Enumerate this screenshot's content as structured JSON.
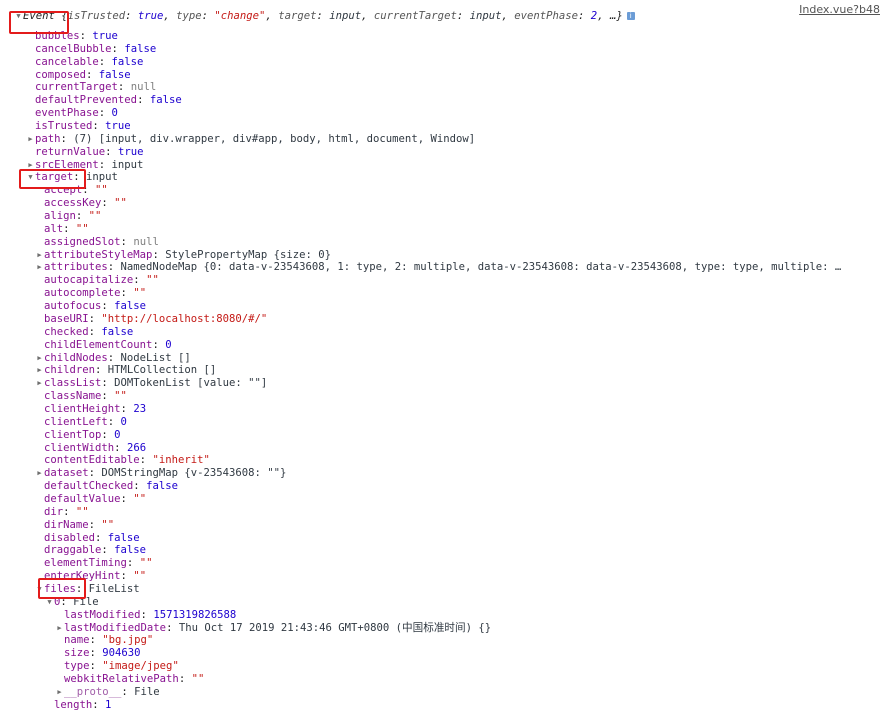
{
  "source_link": "Index.vue?b48",
  "event": {
    "name": "Event",
    "summary_open": "{",
    "summary_items": [
      {
        "key": "isTrusted",
        "val": "true",
        "t": "kw"
      },
      {
        "key": "type",
        "val": "\"change\"",
        "t": "str"
      },
      {
        "key": "target",
        "val": "input",
        "t": "obj"
      },
      {
        "key": "currentTarget",
        "val": "input",
        "t": "obj"
      },
      {
        "key": "eventPhase",
        "val": "2",
        "t": "num"
      }
    ],
    "summary_tail": ", …}",
    "info_icon": "i"
  },
  "lines": [
    {
      "i": 1,
      "tri": "",
      "key": "bubbles",
      "val": "true",
      "t": "kw"
    },
    {
      "i": 1,
      "tri": "",
      "key": "cancelBubble",
      "val": "false",
      "t": "kw"
    },
    {
      "i": 1,
      "tri": "",
      "key": "cancelable",
      "val": "false",
      "t": "kw"
    },
    {
      "i": 1,
      "tri": "",
      "key": "composed",
      "val": "false",
      "t": "kw"
    },
    {
      "i": 1,
      "tri": "",
      "key": "currentTarget",
      "val": "null",
      "t": "nul"
    },
    {
      "i": 1,
      "tri": "",
      "key": "defaultPrevented",
      "val": "false",
      "t": "kw"
    },
    {
      "i": 1,
      "tri": "",
      "key": "eventPhase",
      "val": "0",
      "t": "num"
    },
    {
      "i": 1,
      "tri": "",
      "key": "isTrusted",
      "val": "true",
      "t": "kw"
    },
    {
      "i": 1,
      "tri": "▶",
      "key": "path",
      "val": "(7) [input, div.wrapper, div#app, body, html, document, Window]",
      "t": "obj"
    },
    {
      "i": 1,
      "tri": "",
      "key": "returnValue",
      "val": "true",
      "t": "kw"
    },
    {
      "i": 1,
      "tri": "▶",
      "key": "srcElement",
      "val": "input",
      "t": "obj"
    },
    {
      "i": 1,
      "tri": "▼",
      "key": "target",
      "val": "input",
      "t": "obj"
    },
    {
      "i": 2,
      "tri": "",
      "key": "accept",
      "val": "\"\"",
      "t": "str"
    },
    {
      "i": 2,
      "tri": "",
      "key": "accessKey",
      "val": "\"\"",
      "t": "str"
    },
    {
      "i": 2,
      "tri": "",
      "key": "align",
      "val": "\"\"",
      "t": "str"
    },
    {
      "i": 2,
      "tri": "",
      "key": "alt",
      "val": "\"\"",
      "t": "str"
    },
    {
      "i": 2,
      "tri": "",
      "key": "assignedSlot",
      "val": "null",
      "t": "nul"
    },
    {
      "i": 2,
      "tri": "▶",
      "key": "attributeStyleMap",
      "val": "StylePropertyMap {size: 0}",
      "t": "obj"
    },
    {
      "i": 2,
      "tri": "▶",
      "key": "attributes",
      "val": "NamedNodeMap {0: data-v-23543608, 1: type, 2: multiple, data-v-23543608: data-v-23543608, type: type, multiple: …",
      "t": "obj"
    },
    {
      "i": 2,
      "tri": "",
      "key": "autocapitalize",
      "val": "\"\"",
      "t": "str"
    },
    {
      "i": 2,
      "tri": "",
      "key": "autocomplete",
      "val": "\"\"",
      "t": "str"
    },
    {
      "i": 2,
      "tri": "",
      "key": "autofocus",
      "val": "false",
      "t": "kw"
    },
    {
      "i": 2,
      "tri": "",
      "key": "baseURI",
      "val": "\"http://localhost:8080/#/\"",
      "t": "str"
    },
    {
      "i": 2,
      "tri": "",
      "key": "checked",
      "val": "false",
      "t": "kw"
    },
    {
      "i": 2,
      "tri": "",
      "key": "childElementCount",
      "val": "0",
      "t": "num"
    },
    {
      "i": 2,
      "tri": "▶",
      "key": "childNodes",
      "val": "NodeList []",
      "t": "obj"
    },
    {
      "i": 2,
      "tri": "▶",
      "key": "children",
      "val": "HTMLCollection []",
      "t": "obj"
    },
    {
      "i": 2,
      "tri": "▶",
      "key": "classList",
      "val": "DOMTokenList [value: \"\"]",
      "t": "obj"
    },
    {
      "i": 2,
      "tri": "",
      "key": "className",
      "val": "\"\"",
      "t": "str"
    },
    {
      "i": 2,
      "tri": "",
      "key": "clientHeight",
      "val": "23",
      "t": "num"
    },
    {
      "i": 2,
      "tri": "",
      "key": "clientLeft",
      "val": "0",
      "t": "num"
    },
    {
      "i": 2,
      "tri": "",
      "key": "clientTop",
      "val": "0",
      "t": "num"
    },
    {
      "i": 2,
      "tri": "",
      "key": "clientWidth",
      "val": "266",
      "t": "num"
    },
    {
      "i": 2,
      "tri": "",
      "key": "contentEditable",
      "val": "\"inherit\"",
      "t": "str"
    },
    {
      "i": 2,
      "tri": "▶",
      "key": "dataset",
      "val": "DOMStringMap {v-23543608: \"\"}",
      "t": "obj"
    },
    {
      "i": 2,
      "tri": "",
      "key": "defaultChecked",
      "val": "false",
      "t": "kw"
    },
    {
      "i": 2,
      "tri": "",
      "key": "defaultValue",
      "val": "\"\"",
      "t": "str"
    },
    {
      "i": 2,
      "tri": "",
      "key": "dir",
      "val": "\"\"",
      "t": "str"
    },
    {
      "i": 2,
      "tri": "",
      "key": "dirName",
      "val": "\"\"",
      "t": "str"
    },
    {
      "i": 2,
      "tri": "",
      "key": "disabled",
      "val": "false",
      "t": "kw"
    },
    {
      "i": 2,
      "tri": "",
      "key": "draggable",
      "val": "false",
      "t": "kw"
    },
    {
      "i": 2,
      "tri": "",
      "key": "elementTiming",
      "val": "\"\"",
      "t": "str"
    },
    {
      "i": 2,
      "tri": "",
      "key": "enterKeyHint",
      "val": "\"\"",
      "t": "str"
    },
    {
      "i": 2,
      "tri": "▼",
      "key": "files",
      "val": "FileList",
      "t": "obj"
    },
    {
      "i": 3,
      "tri": "▼",
      "key": "0",
      "val": "File",
      "t": "obj"
    },
    {
      "i": 4,
      "tri": "",
      "key": "lastModified",
      "val": "1571319826588",
      "t": "num"
    },
    {
      "i": 4,
      "tri": "▶",
      "key": "lastModifiedDate",
      "val": "Thu Oct 17 2019 21:43:46 GMT+0800 (中国标准时间) {}",
      "t": "obj"
    },
    {
      "i": 4,
      "tri": "",
      "key": "name",
      "val": "\"bg.jpg\"",
      "t": "str"
    },
    {
      "i": 4,
      "tri": "",
      "key": "size",
      "val": "904630",
      "t": "num"
    },
    {
      "i": 4,
      "tri": "",
      "key": "type",
      "val": "\"image/jpeg\"",
      "t": "str"
    },
    {
      "i": 4,
      "tri": "",
      "key": "webkitRelativePath",
      "val": "\"\"",
      "t": "str"
    },
    {
      "i": 4,
      "tri": "▶",
      "key": "__proto__",
      "val": "File",
      "t": "obj",
      "dim": true
    },
    {
      "i": 3,
      "tri": "",
      "key": "length",
      "val": "1",
      "t": "num"
    }
  ],
  "colors": {
    "highlight_box": "#e31b1b",
    "property_key": "#881391",
    "number": "#1c00cf",
    "string": "#c41a16",
    "null": "#808080",
    "object": "#303942",
    "link": "#545454"
  }
}
